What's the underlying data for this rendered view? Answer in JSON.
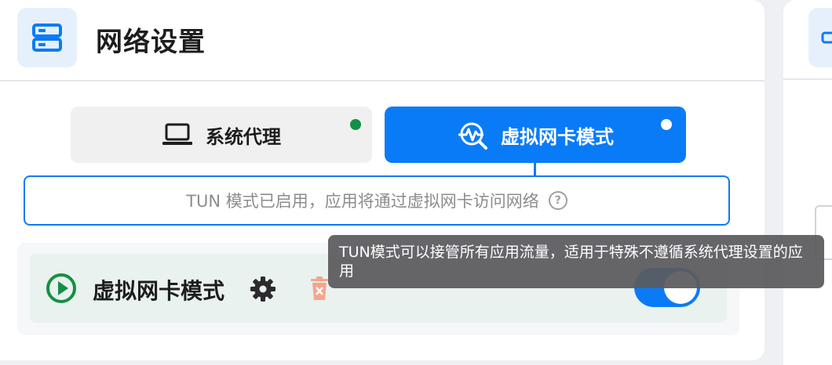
{
  "header": {
    "title": "网络设置",
    "icon": "server-icon"
  },
  "modes": {
    "system_proxy": {
      "label": "系统代理",
      "icon": "laptop-icon",
      "status_color": "#149045"
    },
    "tun": {
      "label": "虚拟网卡模式",
      "icon": "network-pulse-icon",
      "active": true
    }
  },
  "status": {
    "text": "TUN 模式已启用，应用将通过虚拟网卡访问网络",
    "help_icon": "question-circle-icon"
  },
  "tun_item": {
    "label": "虚拟网卡模式",
    "play_icon": "play-circle-icon",
    "settings_icon": "gear-icon",
    "delete_icon": "trash-icon",
    "enabled": true
  },
  "tooltip": {
    "text": "TUN模式可以接管所有应用流量，适用于特殊不遵循系统代理设置的应用"
  },
  "colors": {
    "accent": "#0a7bf7",
    "success": "#149045",
    "danger_soft": "#f5a58c"
  }
}
